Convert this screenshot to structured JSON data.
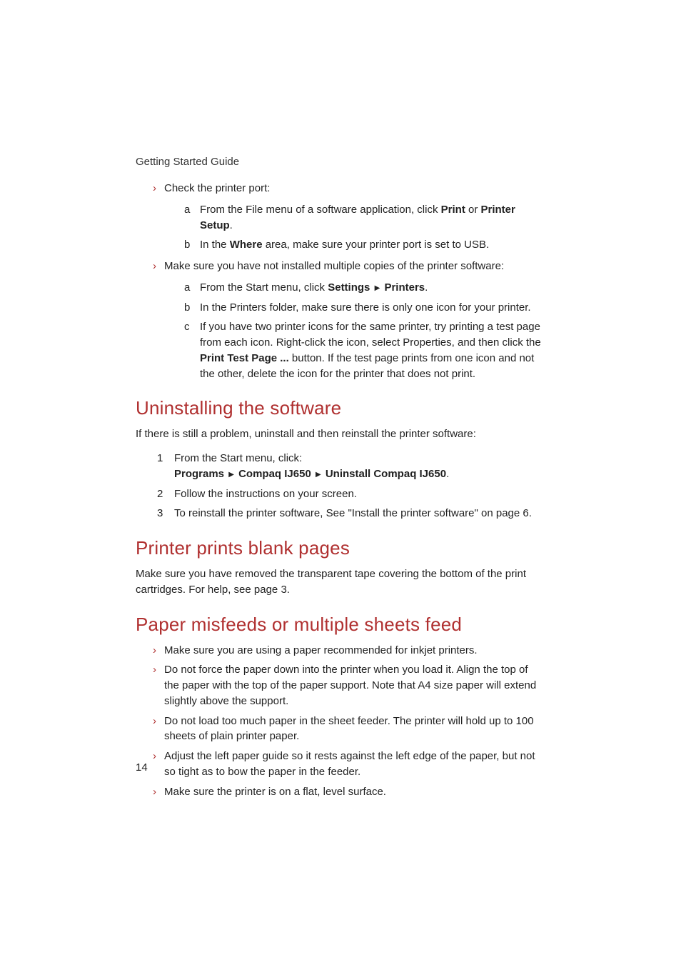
{
  "header": "Getting Started Guide",
  "pageNumber": "14",
  "arrow": "▶",
  "section1": {
    "bullets": [
      {
        "text": "Check the printer port:",
        "sub": [
          {
            "letter": "a",
            "pre": "From the File menu of a software application, click ",
            "b1": "Print",
            "mid": " or ",
            "b2": "Printer Setup",
            "post": "."
          },
          {
            "letter": "b",
            "pre": "In the ",
            "b1": "Where",
            "post": " area, make sure your printer port is set to USB."
          }
        ]
      },
      {
        "text": "Make sure you have not installed multiple copies of the printer software:",
        "sub": [
          {
            "letter": "a",
            "pre": "From the Start menu, click ",
            "b1": "Settings",
            "arrow": true,
            "b2": "Printers",
            "post": "."
          },
          {
            "letter": "b",
            "text": "In the Printers folder, make sure there is only one icon for your printer."
          },
          {
            "letter": "c",
            "pre": "If you have two printer icons for the same printer, try printing a test page from each icon. Right-click the icon, select Properties, and then click the ",
            "b1": "Print Test Page ...",
            "post": " button. If the test page prints from one icon and not the other, delete the icon for the printer that does not print."
          }
        ]
      }
    ]
  },
  "uninstall": {
    "heading": "Uninstalling the software",
    "intro": "If there is still a problem, uninstall and then reinstall the printer software:",
    "steps": [
      {
        "num": "1",
        "line1": "From the Start menu, click:",
        "line2_parts": [
          "Programs",
          "Compaq IJ650",
          "Uninstall Compaq IJ650"
        ],
        "line2_end": "."
      },
      {
        "num": "2",
        "text": "Follow the instructions on your screen."
      },
      {
        "num": "3",
        "text": "To reinstall the printer software, See \"Install the printer software\" on page 6."
      }
    ]
  },
  "blank": {
    "heading": "Printer prints blank pages",
    "text": "Make sure you have removed the transparent tape covering the bottom of the print cartridges. For help, see page 3."
  },
  "misfeed": {
    "heading": "Paper misfeeds or multiple sheets feed",
    "bullets": [
      "Make sure you are using a paper recommended for inkjet printers.",
      "Do not force the paper down into the printer when you load it. Align the top of the paper with the top of the paper support. Note that A4 size paper will extend slightly above the support.",
      "Do not load too much paper in the sheet feeder. The printer will hold up to 100 sheets of plain printer paper.",
      "Adjust the left paper guide so it rests against the left edge of the paper, but not so tight as to bow the paper in the feeder.",
      "Make sure the printer is on a flat, level surface."
    ]
  }
}
